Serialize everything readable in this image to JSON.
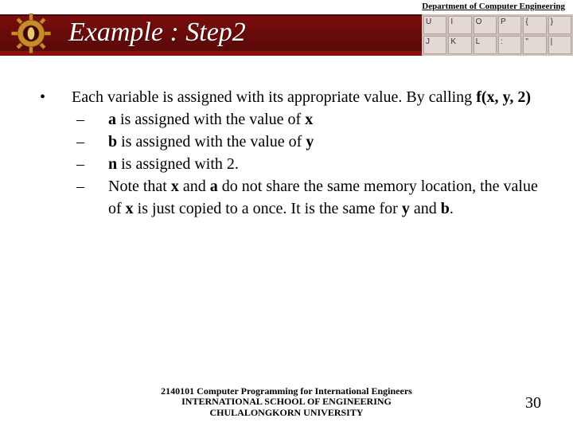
{
  "header": {
    "department": "Department of Computer Engineering",
    "title": "Example  : Step2",
    "keyboard_keys": [
      "U",
      "I",
      "O",
      "P",
      "{",
      "}",
      "J",
      "K",
      "L",
      ":",
      "\"",
      "|"
    ]
  },
  "content": {
    "intro_pre": "Each variable is assigned with its appropriate value. By calling ",
    "intro_bold": "f(x, y, 2)",
    "items": [
      {
        "b1": "a",
        "mid": " is assigned with the value of ",
        "b2": "x",
        "tail": ""
      },
      {
        "b1": "b",
        "mid": " is assigned with the value of ",
        "b2": "y",
        "tail": ""
      },
      {
        "b1": "n",
        "mid": " is assigned with 2.",
        "b2": "",
        "tail": ""
      }
    ],
    "note_parts": {
      "p0": "Note that ",
      "b_x": "x",
      "p1": " and ",
      "b_a": "a",
      "p2": " do not share the same memory location, the value of ",
      "b_x2": "x",
      "p3": " is just copied to a once. It is the same for ",
      "b_y": "y",
      "p4": " and ",
      "b_b": "b",
      "p5": "."
    }
  },
  "footer": {
    "line1": "2140101 Computer Programming for International Engineers",
    "line2": "INTERNATIONAL SCHOOL OF ENGINEERING",
    "line3": "CHULALONGKORN UNIVERSITY",
    "page": "30"
  }
}
